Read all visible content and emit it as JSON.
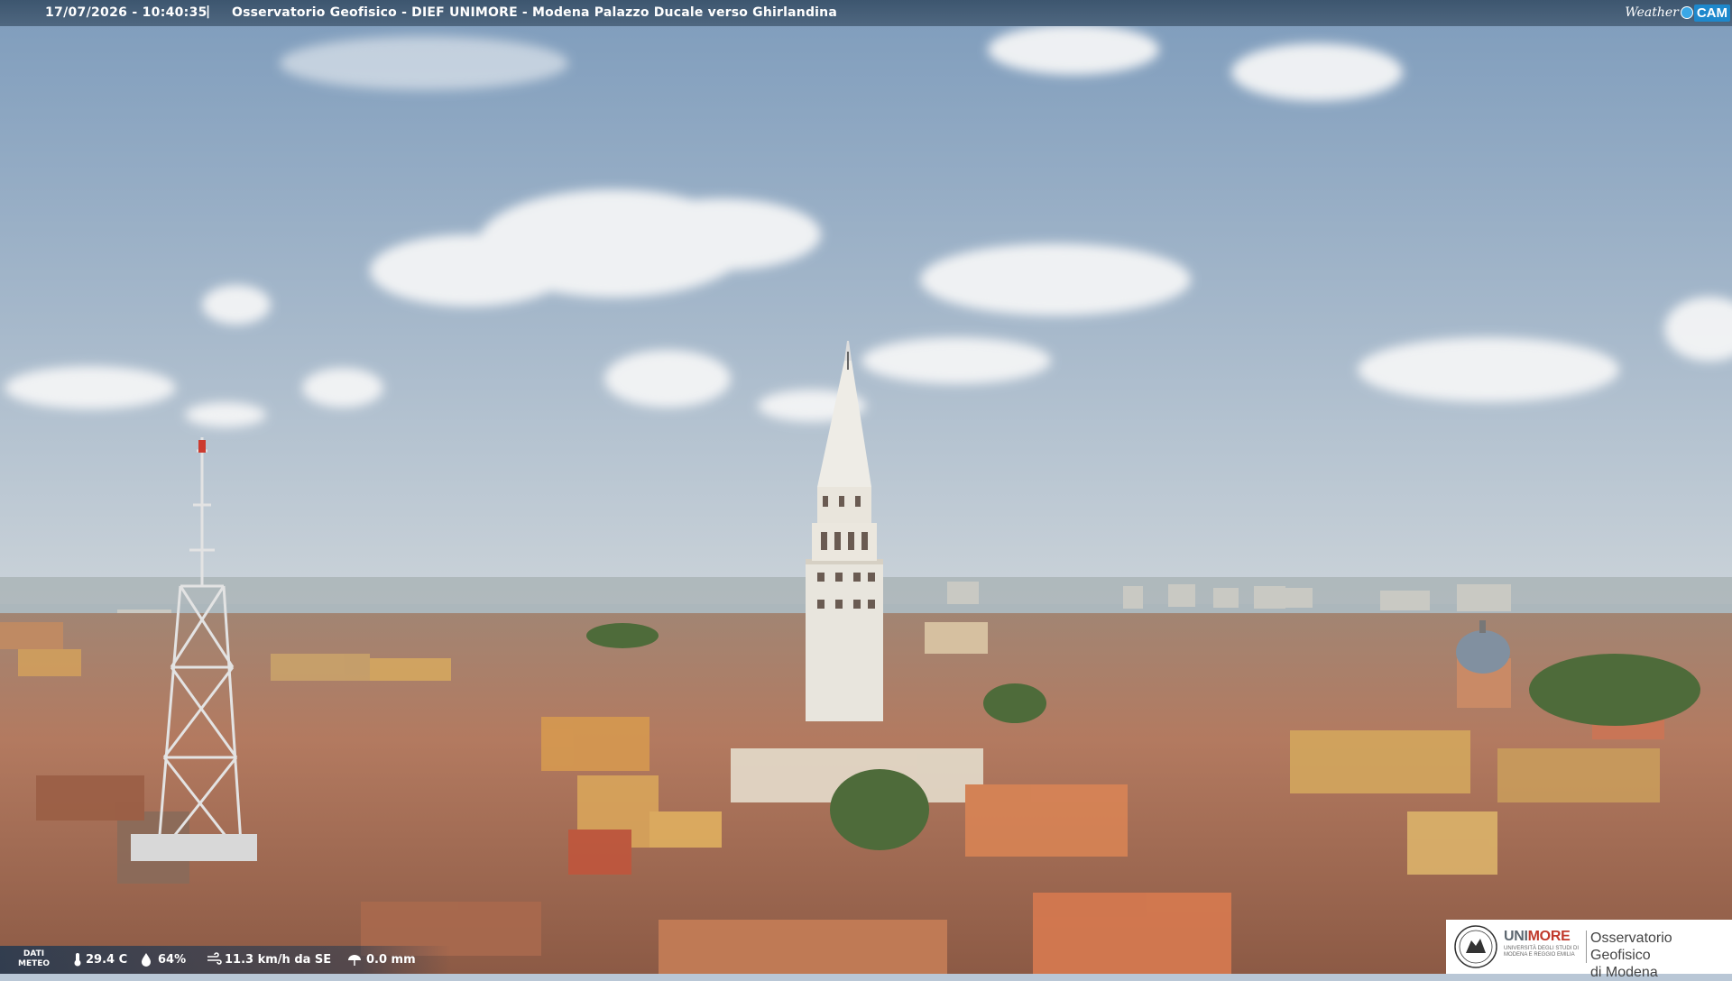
{
  "overlay": {
    "timestamp": "17/07/2026 - 10:40:35",
    "separator": "|",
    "caption": "Osservatorio Geofisico - DIEF UNIMORE - Modena Palazzo Ducale verso Ghirlandina",
    "brand_weather": "Weather",
    "brand_cam": "CAM"
  },
  "weather": {
    "label_line1": "DATI",
    "label_line2": "METEO",
    "temperature": "29.4 C",
    "humidity": "64%",
    "wind": "11.3 km/h da SE",
    "rain": "0.0 mm"
  },
  "logo": {
    "uni": "UNI",
    "more": "MORE",
    "sub_line1": "UNIVERSITÀ DEGLI STUDI DI",
    "sub_line2": "MODENA E REGGIO EMILIA",
    "org_line1": "Osservatorio Geofisico",
    "org_line2": "di Modena"
  },
  "colors": {
    "sky_top": "#7d9bbb",
    "sky_bottom": "#c6d0d8",
    "roof": "#b5735a",
    "tower": "#e9e6de",
    "accent_red": "#c0392b"
  }
}
